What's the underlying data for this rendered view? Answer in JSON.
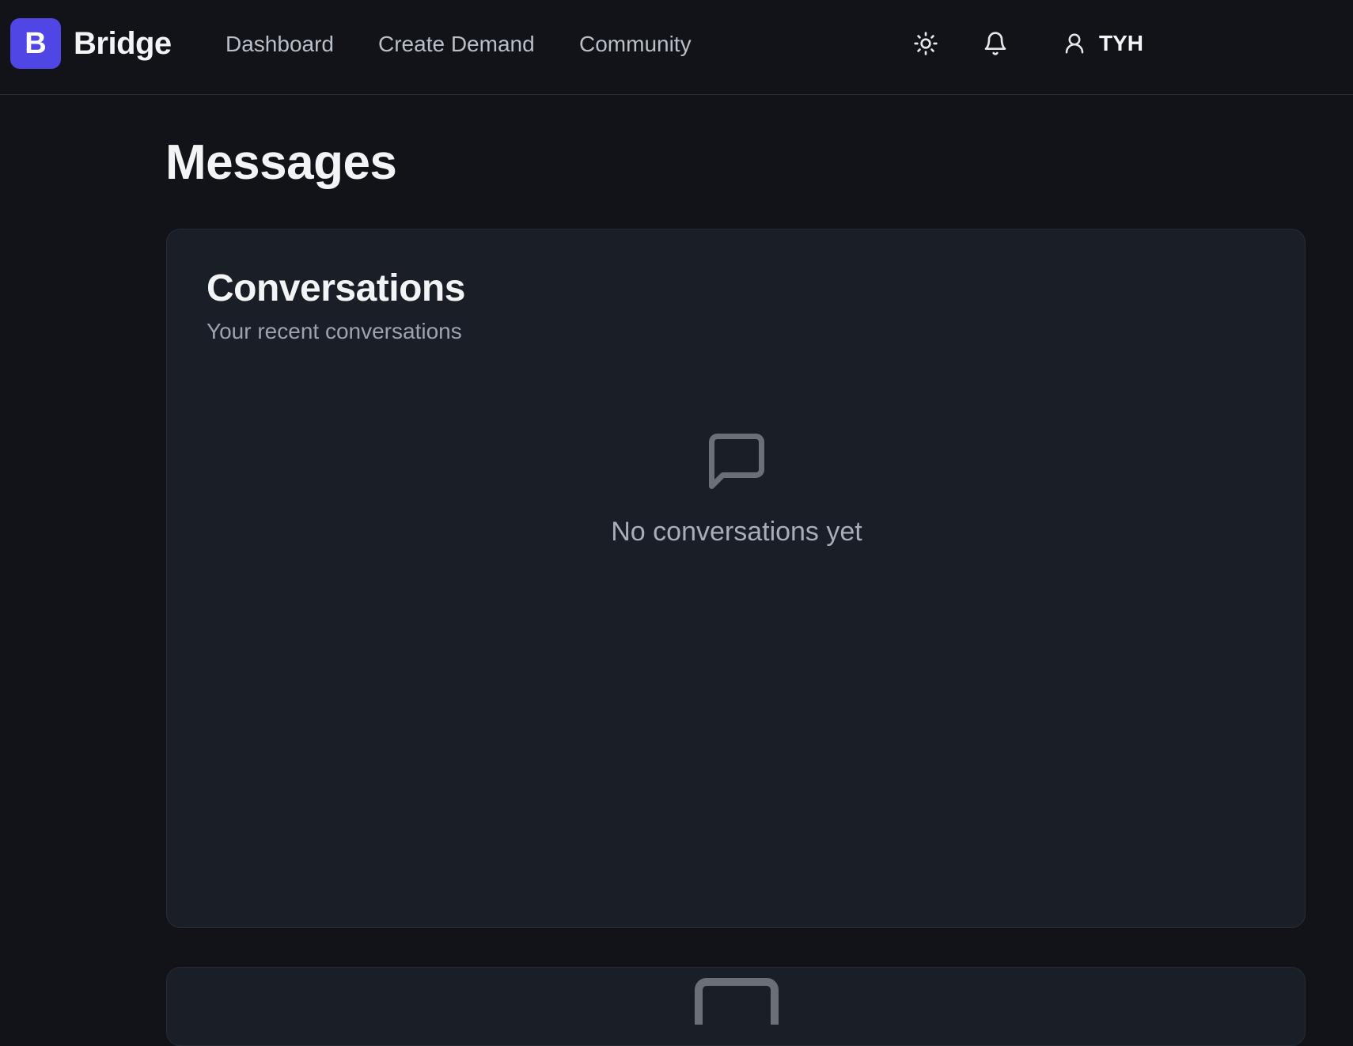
{
  "header": {
    "logo_letter": "B",
    "brand": "Bridge",
    "nav": [
      {
        "label": "Dashboard"
      },
      {
        "label": "Create Demand"
      },
      {
        "label": "Community"
      }
    ],
    "theme_toggle_icon": "sun-icon",
    "notifications_icon": "bell-icon",
    "user": {
      "icon": "user-icon",
      "name": "TYH"
    }
  },
  "page": {
    "title": "Messages"
  },
  "conversations": {
    "title": "Conversations",
    "subtitle": "Your recent conversations",
    "empty_icon": "message-square-icon",
    "empty_text": "No conversations yet"
  },
  "colors": {
    "background": "#111318",
    "card": "#1a1e26",
    "accent": "#4f46e5",
    "muted_text": "#9ca3af"
  }
}
